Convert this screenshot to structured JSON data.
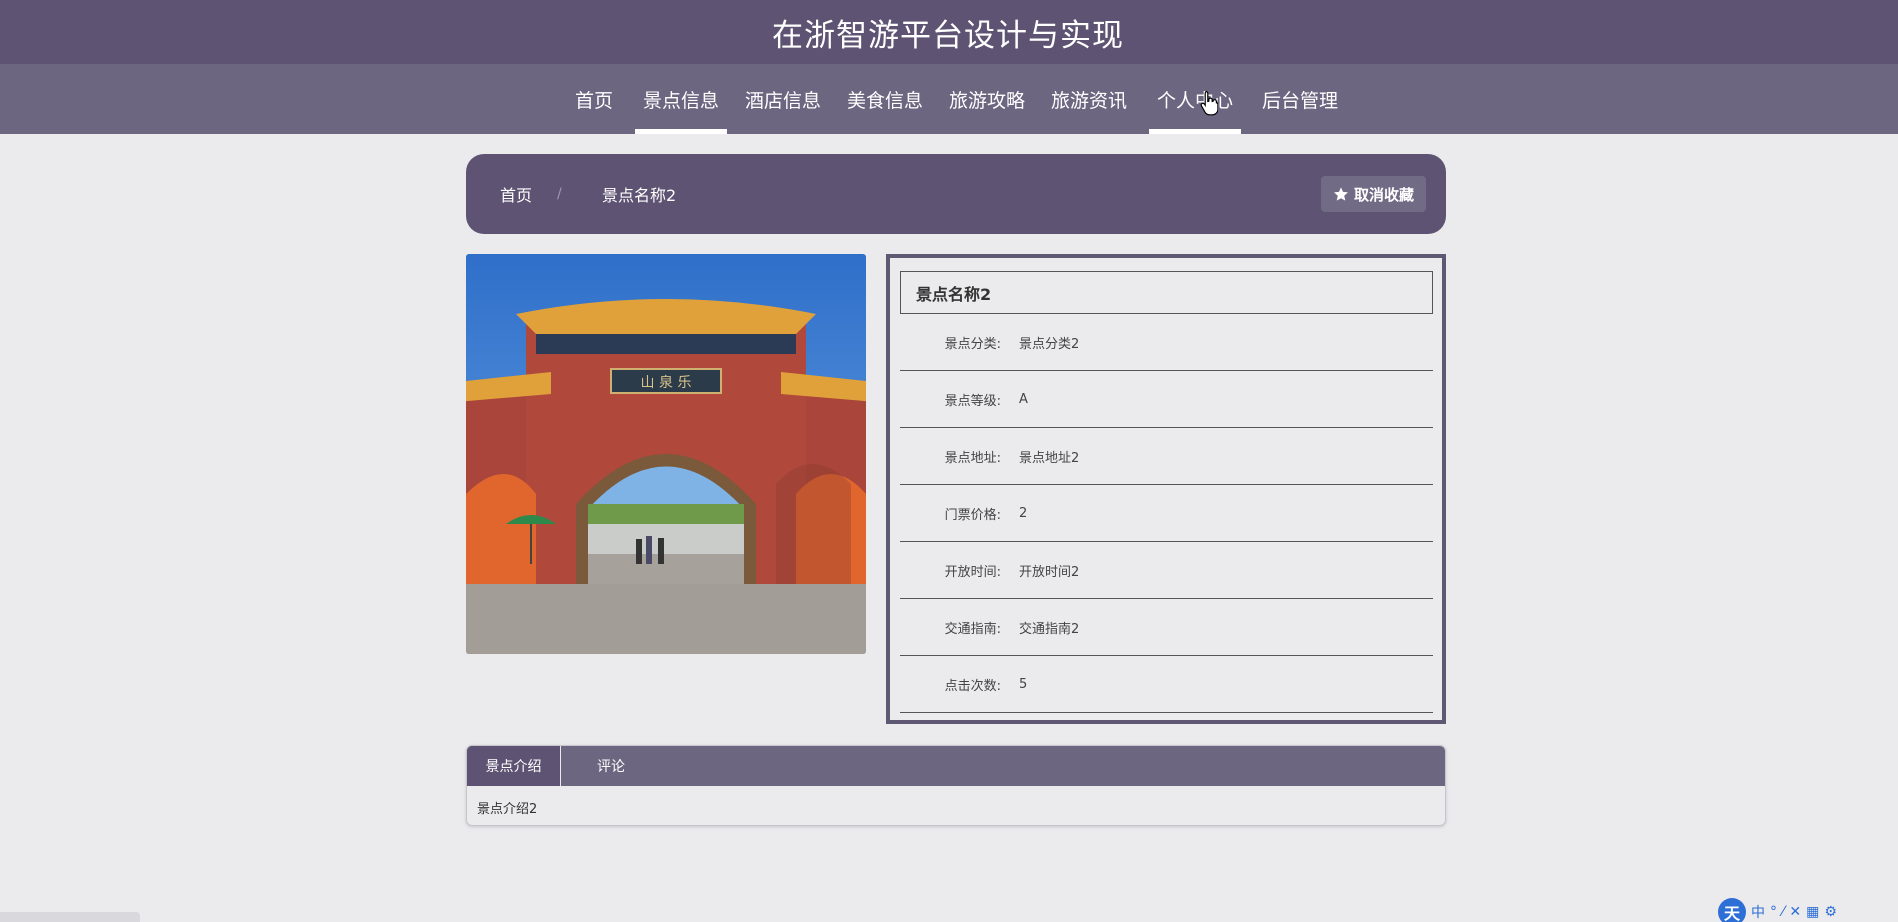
{
  "header": {
    "title": "在浙智游平台设计与实现"
  },
  "nav": {
    "items": [
      {
        "label": "首页"
      },
      {
        "label": "景点信息"
      },
      {
        "label": "酒店信息"
      },
      {
        "label": "美食信息"
      },
      {
        "label": "旅游攻略"
      },
      {
        "label": "旅游资讯"
      },
      {
        "label": "个人中心"
      },
      {
        "label": "后台管理"
      }
    ]
  },
  "breadcrumb": {
    "home": "首页",
    "separator": "/",
    "current": "景点名称2"
  },
  "actions": {
    "favorite_label": "取消收藏"
  },
  "detail": {
    "title": "景点名称2",
    "rows": [
      {
        "label": "景点分类:",
        "value": "景点分类2"
      },
      {
        "label": "景点等级:",
        "value": "A"
      },
      {
        "label": "景点地址:",
        "value": "景点地址2"
      },
      {
        "label": "门票价格:",
        "value": "2"
      },
      {
        "label": "开放时间:",
        "value": "开放时间2"
      },
      {
        "label": "交通指南:",
        "value": "交通指南2"
      },
      {
        "label": "点击次数:",
        "value": "5"
      }
    ]
  },
  "tabs": {
    "items": [
      {
        "label": "景点介绍"
      },
      {
        "label": "评论"
      }
    ],
    "content": "景点介绍2"
  },
  "ime": {
    "logo": "天",
    "glyphs": [
      "中",
      "°",
      "⁄",
      "✕",
      "▦",
      "⚙"
    ]
  },
  "colors": {
    "primary": "#5e5373",
    "nav": "#6c6680",
    "background": "#ebeaec"
  }
}
